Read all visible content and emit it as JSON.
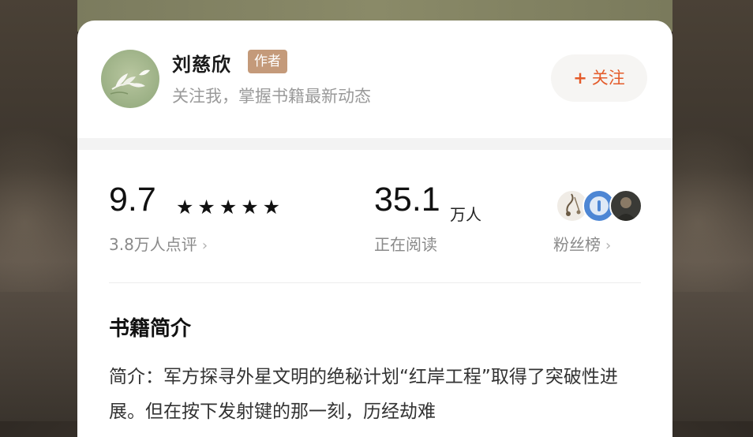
{
  "author": {
    "name": "刘慈欣",
    "badge": "作者",
    "subtitle": "关注我，掌握书籍最新动态",
    "follow_label": "关注",
    "avatar_icon": "leaf-avatar-icon"
  },
  "stats": {
    "rating": "9.7",
    "stars": "★★★★★",
    "rating_count": "3.8万人点评",
    "readers": "35.1",
    "readers_unit": "万人",
    "readers_label": "正在阅读",
    "fans_label": "粉丝榜"
  },
  "intro": {
    "title": "书籍简介",
    "text": "简介：军方探寻外星文明的绝秘计划“红岸工程”取得了突破性进展。但在按下发射键的那一刻，历经劫难"
  },
  "colors": {
    "accent": "#e45b2a",
    "badge": "#c49a7a"
  }
}
